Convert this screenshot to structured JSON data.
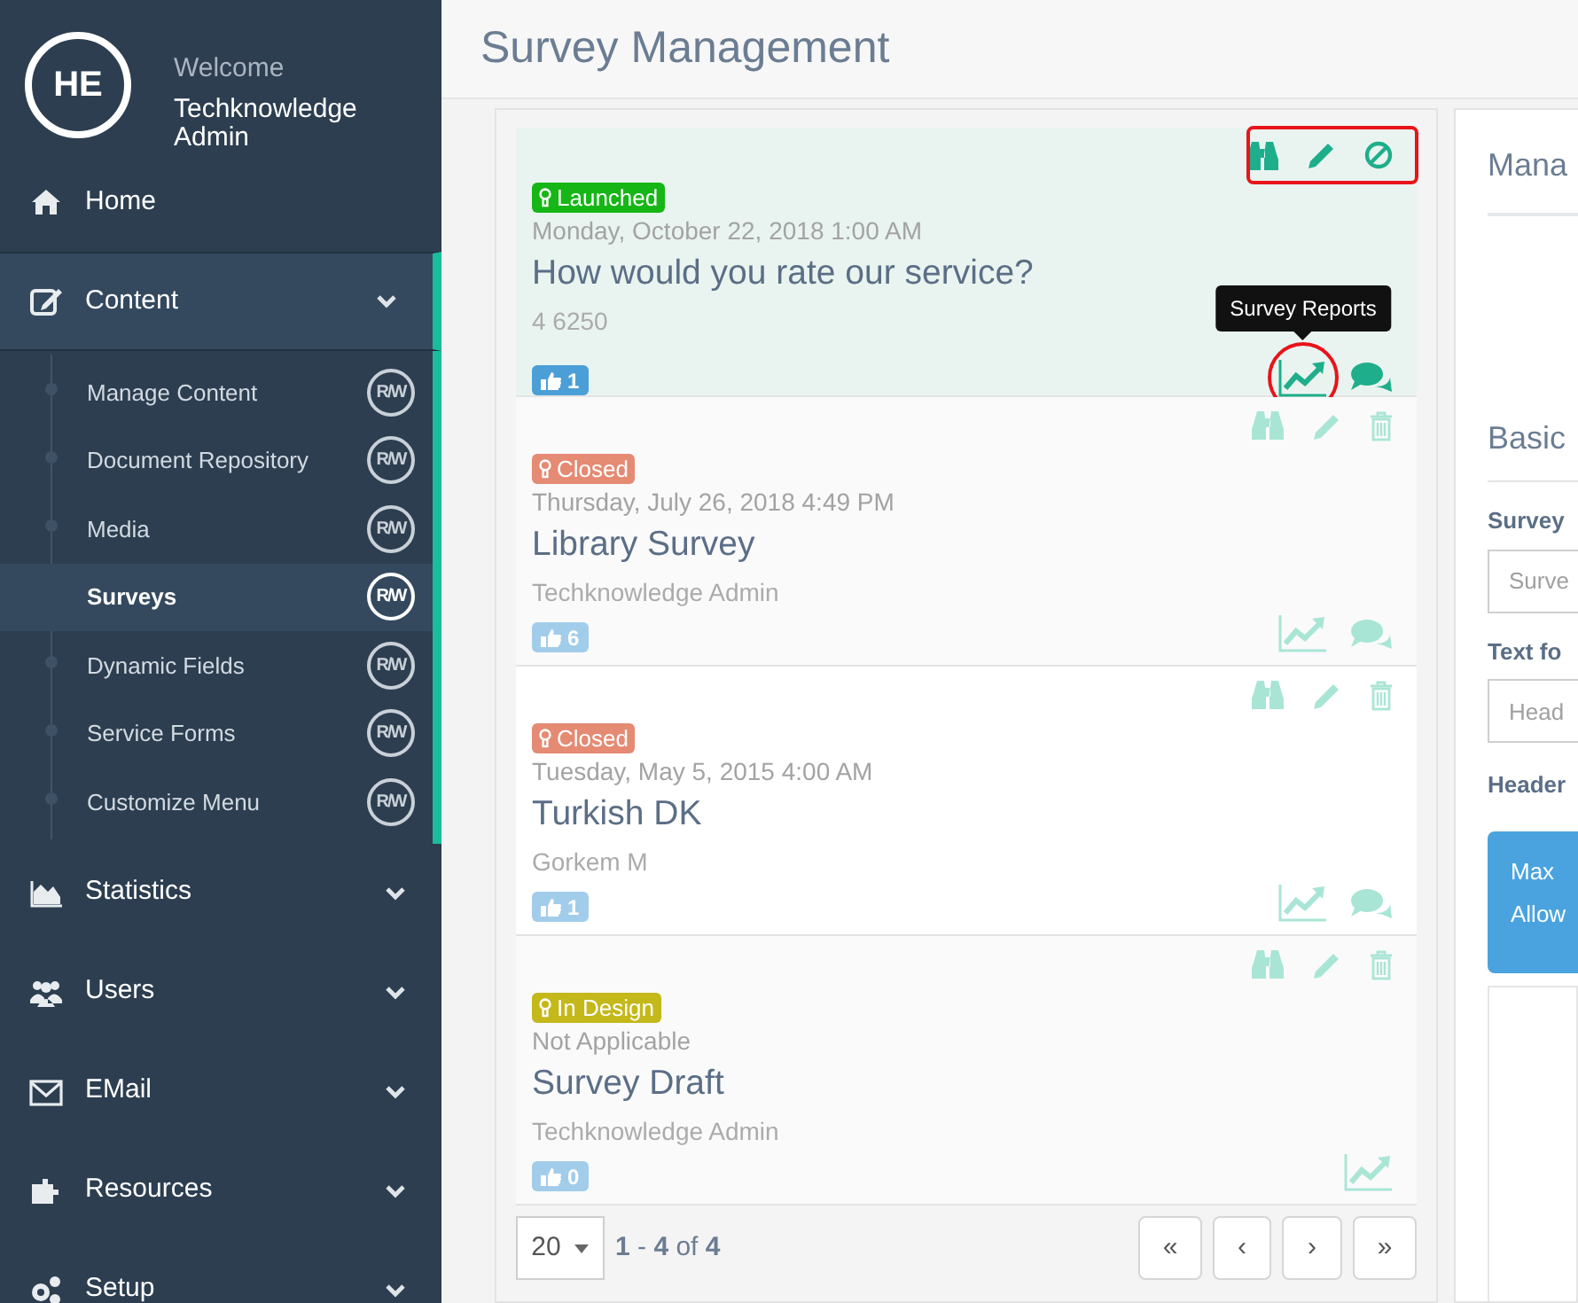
{
  "page_title": "Survey Management",
  "sidebar": {
    "avatar": "HE",
    "welcome": "Welcome",
    "user": "Techknowledge Admin",
    "items": [
      {
        "label": "Home",
        "kind": "home"
      },
      {
        "label": "Content",
        "kind": "edit",
        "expanded": true,
        "children": [
          {
            "label": "Manage Content",
            "badge": "R/W",
            "selected": false
          },
          {
            "label": "Document Repository",
            "badge": "R/W",
            "selected": false
          },
          {
            "label": "Media",
            "badge": "R/W",
            "selected": false
          },
          {
            "label": "Surveys",
            "badge": "R/W",
            "selected": true
          },
          {
            "label": "Dynamic Fields",
            "badge": "R/W",
            "selected": false
          },
          {
            "label": "Service Forms",
            "badge": "R/W",
            "selected": false
          },
          {
            "label": "Customize Menu",
            "badge": "R/W",
            "selected": false
          }
        ]
      },
      {
        "label": "Statistics",
        "kind": "chart",
        "expanded": false
      },
      {
        "label": "Users",
        "kind": "users",
        "expanded": false
      },
      {
        "label": "EMail",
        "kind": "mail",
        "expanded": false
      },
      {
        "label": "Resources",
        "kind": "puzzle",
        "expanded": false
      },
      {
        "label": "Setup",
        "kind": "gears",
        "expanded": false
      }
    ]
  },
  "surveys": [
    {
      "status": {
        "label": "Launched",
        "kind": "launched"
      },
      "date": "Monday, October 22, 2018 1:00 AM",
      "title": "How would you rate our service?",
      "author": "4 6250",
      "likes": "1",
      "selected": true,
      "top_marked": true,
      "top_actions": [
        {
          "kind": "view"
        },
        {
          "kind": "edit"
        },
        {
          "kind": "disable"
        }
      ],
      "bottom_actions": [
        {
          "kind": "report",
          "marked": true,
          "tooltip": "Survey Reports"
        },
        {
          "kind": "comments",
          "marked": false
        }
      ]
    },
    {
      "status": {
        "label": "Closed",
        "kind": "closed"
      },
      "date": "Thursday, July 26, 2018 4:49 PM",
      "title": "Library Survey",
      "author": "Techknowledge Admin",
      "likes": "6",
      "selected": false,
      "top_marked": false,
      "top_actions": [
        {
          "kind": "view"
        },
        {
          "kind": "edit"
        },
        {
          "kind": "delete"
        }
      ],
      "bottom_actions": [
        {
          "kind": "report",
          "marked": false
        },
        {
          "kind": "comments",
          "marked": false
        }
      ]
    },
    {
      "status": {
        "label": "Closed",
        "kind": "closed"
      },
      "date": "Tuesday, May 5, 2015 4:00 AM",
      "title": "Turkish DK",
      "author": "Gorkem M",
      "likes": "1",
      "selected": false,
      "top_marked": false,
      "top_actions": [
        {
          "kind": "view"
        },
        {
          "kind": "edit"
        },
        {
          "kind": "delete"
        }
      ],
      "bottom_actions": [
        {
          "kind": "report",
          "marked": false
        },
        {
          "kind": "comments",
          "marked": false
        }
      ]
    },
    {
      "status": {
        "label": "In Design",
        "kind": "design"
      },
      "date": "Not Applicable",
      "title": "Survey Draft",
      "author": "Techknowledge Admin",
      "likes": "0",
      "selected": false,
      "top_marked": false,
      "top_actions": [
        {
          "kind": "view"
        },
        {
          "kind": "edit"
        },
        {
          "kind": "delete"
        }
      ],
      "bottom_actions": [
        {
          "kind": "report",
          "marked": false
        }
      ]
    }
  ],
  "pagination": {
    "page_size": "20",
    "range": "**1** - **4** of **4**",
    "buttons": [
      "«",
      "‹",
      "›",
      "»"
    ]
  },
  "detail": {
    "heading": "Mana",
    "section": "Basic",
    "fields": [
      {
        "label": "Survey",
        "placeholder": "Surve"
      },
      {
        "label": "Text fo",
        "placeholder": "Head"
      }
    ],
    "header_label": "Header",
    "info_lines": [
      "Max",
      "Allow"
    ]
  }
}
